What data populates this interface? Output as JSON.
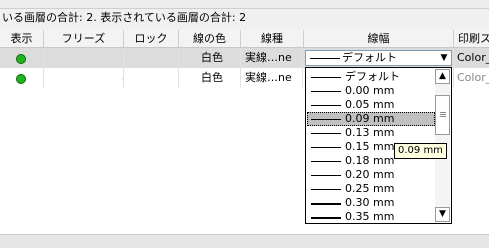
{
  "status": {
    "text": "いる画層の合計: 2. 表示されている画層の合計: 2"
  },
  "columns": [
    "表示",
    "フリーズ",
    "ロック",
    "線の色",
    "線種",
    "線幅",
    "印刷ス"
  ],
  "rows": [
    {
      "color": "白色",
      "linetype": "実線…ne",
      "plot": "Color_"
    },
    {
      "color": "白色",
      "linetype": "実線…ne",
      "plot": "Color_"
    }
  ],
  "lineweight_combo": {
    "value": "デフォルト",
    "arrow": "▼"
  },
  "lineweight_options": [
    {
      "label": "デフォルト",
      "weight": 1
    },
    {
      "label": "0.00 mm",
      "weight": 1
    },
    {
      "label": "0.05 mm",
      "weight": 1
    },
    {
      "label": "0.09 mm",
      "weight": 1
    },
    {
      "label": "0.13 mm",
      "weight": 1
    },
    {
      "label": "0.15 mm",
      "weight": 1
    },
    {
      "label": "0.18 mm",
      "weight": 1
    },
    {
      "label": "0.20 mm",
      "weight": 1
    },
    {
      "label": "0.25 mm",
      "weight": 1
    },
    {
      "label": "0.30 mm",
      "weight": 2
    },
    {
      "label": "0.35 mm",
      "weight": 2
    }
  ],
  "selected_index": 3,
  "tooltip": {
    "text": "0.09 mm"
  },
  "scroll": {
    "up": "▲",
    "down": "▼"
  }
}
